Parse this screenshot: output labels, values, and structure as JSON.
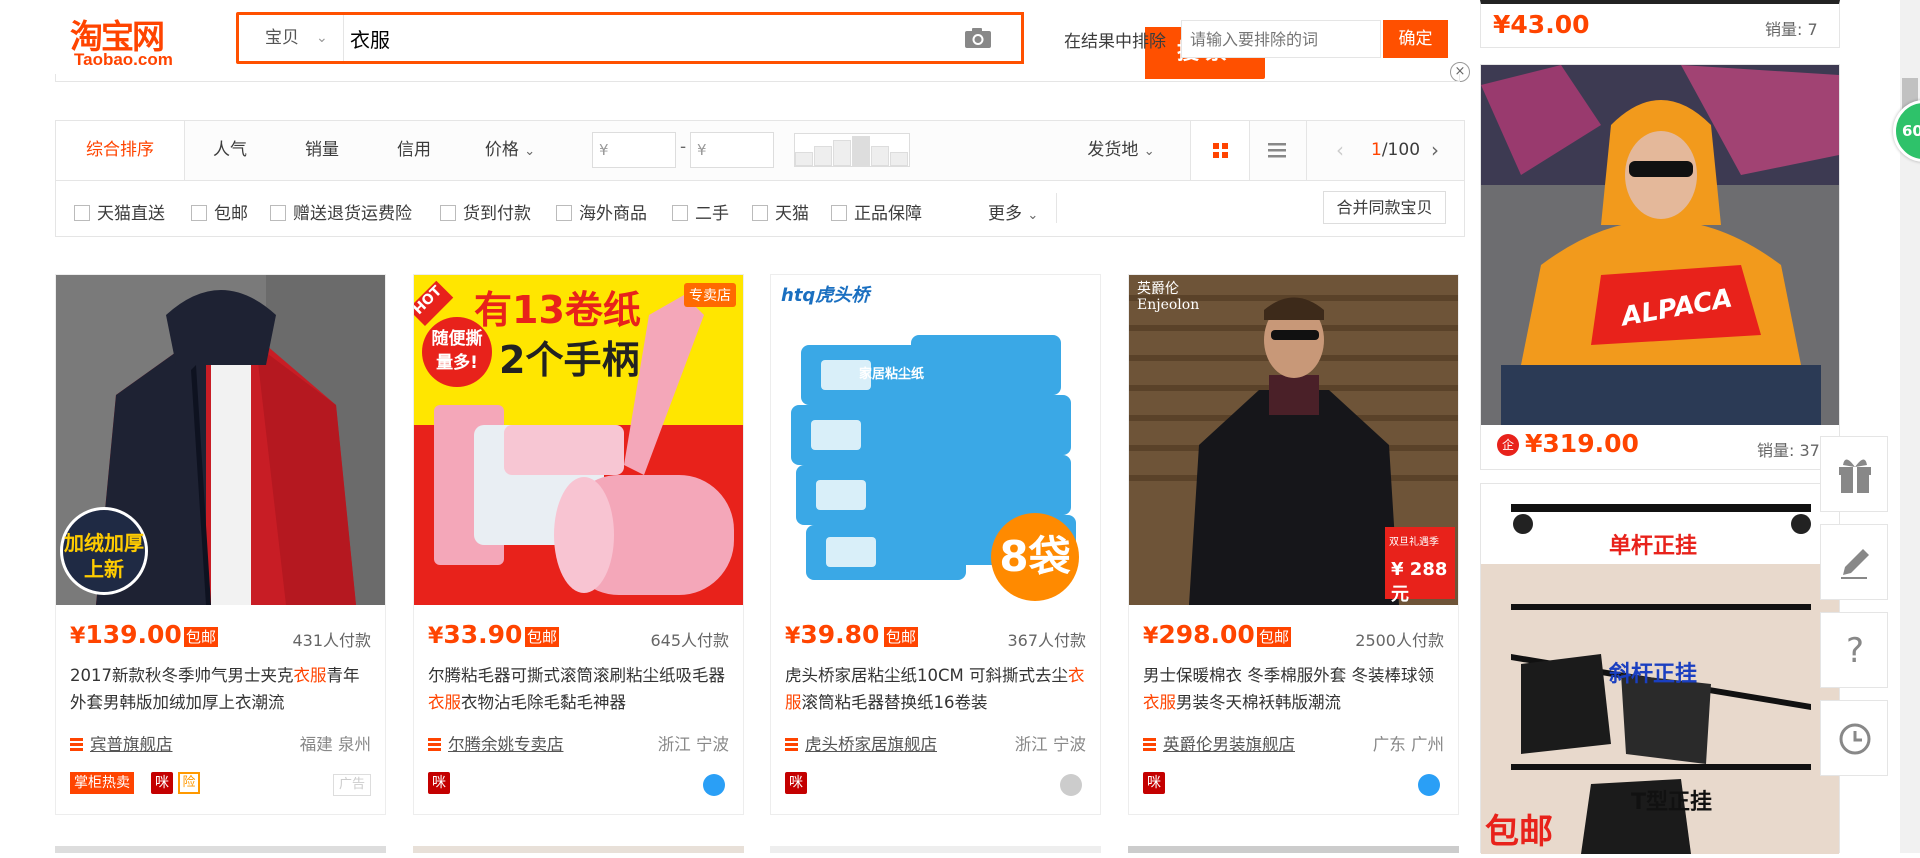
{
  "header": {
    "logo_cn": "淘宝网",
    "logo_en": "Taobao.com",
    "search_type": "宝贝",
    "search_value": "衣服",
    "search_button": "搜索",
    "exclude_label": "在结果中排除",
    "exclude_placeholder": "请输入要排除的词",
    "exclude_button": "确定",
    "close": "×"
  },
  "sortbar": {
    "items": [
      "综合排序",
      "人气",
      "销量",
      "信用",
      "价格"
    ],
    "price_min_placeholder": "¥",
    "price_max_placeholder": "¥",
    "price_dash": "-",
    "ship_from": "发货地",
    "pager_current": "1",
    "pager_total": "/100"
  },
  "filters": {
    "items": [
      "天猫直送",
      "包邮",
      "赠送退货运费险",
      "货到付款",
      "海外商品",
      "二手",
      "天猫",
      "正品保障"
    ],
    "more": "更多",
    "merge_button": "合并同款宝贝"
  },
  "products": [
    {
      "price": "139.00",
      "free_shipping": "包邮",
      "sold": "431人付款",
      "title_pre": "2017新款秋冬季帅气男士夹克",
      "title_hl": "衣服",
      "title_post": "青年外套男韩版加绒加厚上衣潮流",
      "shop": "宾普旗舰店",
      "location": "福建 泉州",
      "image_text": "加绒加厚\n上新",
      "badge_1": "掌柜热卖",
      "ad_label": "广告"
    },
    {
      "price": "33.90",
      "free_shipping": "包邮",
      "sold": "645人付款",
      "title_pre": "尔腾粘毛器可撕式滚筒滚刷粘尘纸吸毛器",
      "title_hl": "衣服",
      "title_post": "衣物沾毛除毛黏毛神器",
      "shop": "尔腾余姚专卖店",
      "location": "浙江 宁波",
      "image_text_1": "有13卷纸",
      "image_text_2": "2个手柄",
      "image_text_3": "随便撕\n量多!",
      "image_tag": "HOT",
      "image_store": "专卖店"
    },
    {
      "price": "39.80",
      "free_shipping": "包邮",
      "sold": "367人付款",
      "title_pre": "虎头桥家居粘尘纸10CM 可斜撕式去尘",
      "title_hl": "衣服",
      "title_post": "滚筒粘毛器替换纸16卷装",
      "shop": "虎头桥家居旗舰店",
      "location": "浙江 宁波",
      "image_brand": "htq虎头桥",
      "image_badge": "8袋",
      "image_pack": "家居粘尘纸"
    },
    {
      "price": "298.00",
      "free_shipping": "包邮",
      "sold": "2500人付款",
      "title_pre": "男士保暖棉衣 冬季棉服外套 冬装棒球领",
      "title_hl": "衣服",
      "title_post": "男装冬天棉袄韩版潮流",
      "shop": "英爵伦男装旗舰店",
      "location": "广东 广州",
      "image_brand": "英爵伦\nEnjeolon",
      "image_price": "¥ 288 元",
      "image_promo": "双旦礼遇季"
    }
  ],
  "rail": {
    "item1_price": "43.00",
    "item1_sold": "销量: 7",
    "item2_price": "319.00",
    "item2_sold": "销量: 37",
    "item2_shirt_text": "ALPACA",
    "item3_label_1": "单杆正挂",
    "item3_label_2": "斜杆正挂",
    "item3_label_3": "T型正挂",
    "item3_tag": "包邮"
  },
  "float_badge": "60",
  "colors": {
    "accent": "#ff4400",
    "search_orange": "#ff5000",
    "link": "#3c3c3c"
  }
}
